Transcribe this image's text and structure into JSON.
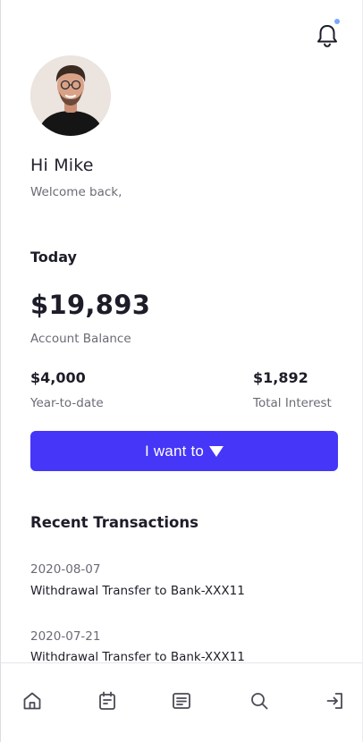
{
  "header": {
    "notifications_icon": "bell-icon",
    "notification_dot_color": "#7aa6ff"
  },
  "profile": {
    "avatar_icon": "avatar",
    "greeting": "Hi Mike",
    "subtitle": "Welcome back,"
  },
  "summary": {
    "period": "Today",
    "balance": "$19,893",
    "balance_label": "Account Balance",
    "ytd_value": "$4,000",
    "ytd_label": "Year-to-date",
    "interest_value": "$1,892",
    "interest_label": "Total Interest"
  },
  "action": {
    "label": "I want to",
    "accent_color": "#4636f7",
    "icon": "caret-down-icon"
  },
  "transactions": {
    "title": "Recent Transactions",
    "items": [
      {
        "date": "2020-08-07",
        "description": "Withdrawal Transfer to Bank-XXX11"
      },
      {
        "date": "2020-07-21",
        "description": "Withdrawal Transfer to Bank-XXX11"
      }
    ]
  },
  "nav": {
    "items": [
      {
        "icon": "home-icon"
      },
      {
        "icon": "calendar-icon"
      },
      {
        "icon": "document-icon"
      },
      {
        "icon": "search-icon"
      },
      {
        "icon": "logout-icon"
      }
    ]
  }
}
